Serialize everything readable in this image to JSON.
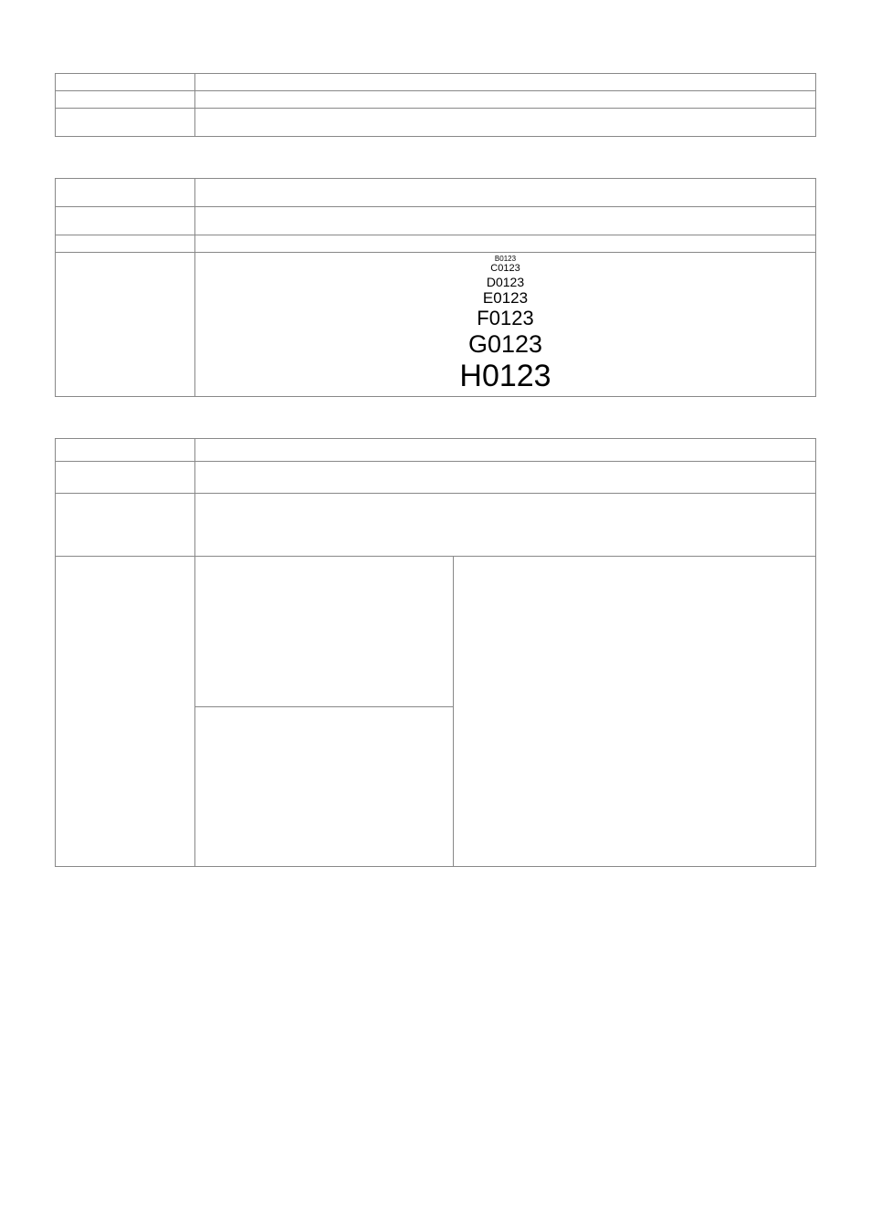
{
  "block2": {
    "example": [
      "B0123",
      "C0123",
      "D0123",
      "E0123",
      "F0123",
      "G0123",
      "H0123"
    ]
  }
}
